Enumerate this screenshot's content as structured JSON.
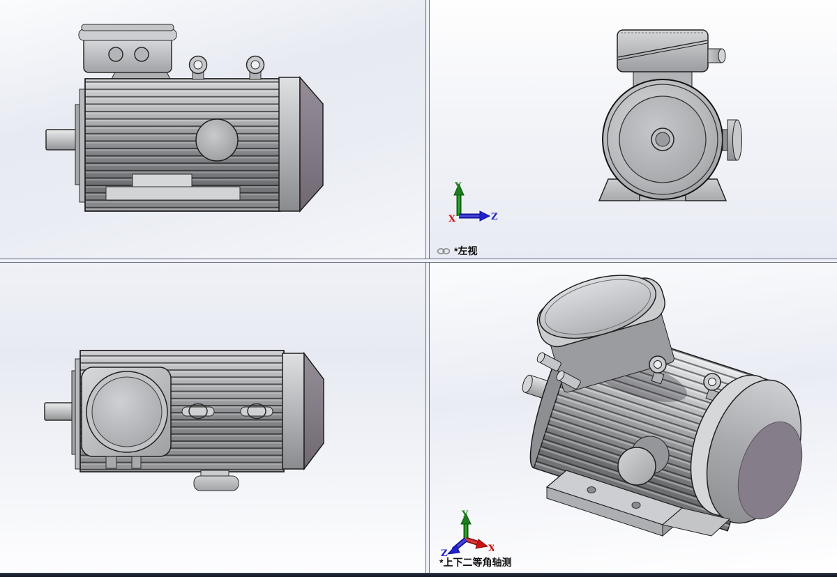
{
  "viewport_labels": {
    "top_right": "*左视",
    "bottom_right": "*上下二等角轴测"
  },
  "triad_top_right": {
    "x": "X",
    "y": "Y",
    "z": "Z"
  },
  "triad_bottom_right": {
    "x": "X",
    "y": "Y",
    "z": "Z"
  },
  "icons": {
    "link_icon": "chain-link"
  },
  "colors": {
    "axis_x": "#cc1111",
    "axis_y": "#1e7d1e",
    "axis_z": "#2222cc",
    "splitter_edge": "#6b6e85",
    "splitter_fill": "#eef0f7",
    "bottom_bar": "#1e2433",
    "outline": "#1f1f1f",
    "metal_light": "#d6d7d9",
    "metal_mid": "#a8a9ac",
    "metal_dark": "#77787b",
    "fan_cap_purple": "#847b88",
    "label_text": "#101010"
  }
}
